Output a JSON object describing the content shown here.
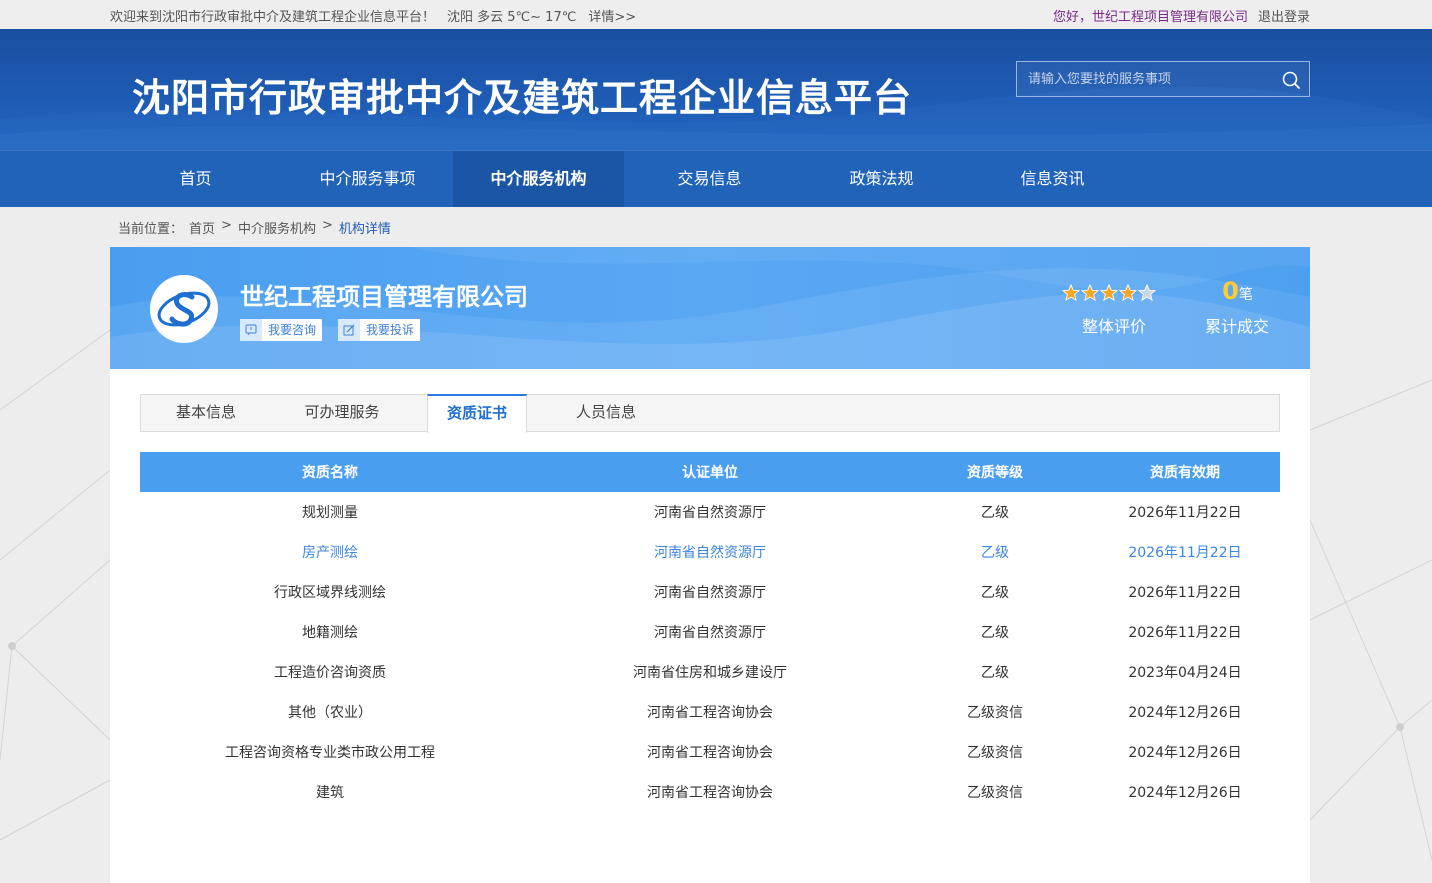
{
  "topbar": {
    "welcome": "欢迎来到沈阳市行政审批中介及建筑工程企业信息平台！",
    "weather": "沈阳 多云 5℃~ 17℃",
    "details": "详情>>",
    "greeting": "您好，世纪工程项目管理有限公司",
    "logout": "退出登录"
  },
  "header": {
    "site_title": "沈阳市行政审批中介及建筑工程企业信息平台",
    "search_placeholder": "请输入您要找的服务事项"
  },
  "nav": {
    "items": [
      "首页",
      "中介服务事项",
      "中介服务机构",
      "交易信息",
      "政策法规",
      "信息资讯"
    ],
    "active": "中介服务机构"
  },
  "breadcrumb": {
    "label": "当前位置：",
    "home": "首页",
    "sep": ">",
    "level1": "中介服务机构",
    "current": "机构详情"
  },
  "company": {
    "name": "世纪工程项目管理有限公司",
    "consult_label": "我要咨询",
    "complain_label": "我要投诉",
    "rating_stars": 4,
    "rating_max": 5,
    "rating_label": "整体评价",
    "deals_count": "0",
    "deals_unit": "笔",
    "deals_label": "累计成交"
  },
  "tabs": {
    "items": [
      "基本信息",
      "可办理服务",
      "资质证书",
      "人员信息"
    ],
    "active": "资质证书"
  },
  "table": {
    "headers": [
      "资质名称",
      "认证单位",
      "资质等级",
      "资质有效期"
    ],
    "rows": [
      [
        "规划测量",
        "河南省自然资源厅",
        "乙级",
        "2026年11月22日"
      ],
      [
        "房产测绘",
        "河南省自然资源厅",
        "乙级",
        "2026年11月22日"
      ],
      [
        "行政区域界线测绘",
        "河南省自然资源厅",
        "乙级",
        "2026年11月22日"
      ],
      [
        "地籍测绘",
        "河南省自然资源厅",
        "乙级",
        "2026年11月22日"
      ],
      [
        "工程造价咨询资质",
        "河南省住房和城乡建设厅",
        "乙级",
        "2023年04月24日"
      ],
      [
        "其他（农业）",
        "河南省工程咨询协会",
        "乙级资信",
        "2024年12月26日"
      ],
      [
        "工程咨询资格专业类市政公用工程",
        "河南省工程咨询协会",
        "乙级资信",
        "2024年12月26日"
      ],
      [
        "建筑",
        "河南省工程咨询协会",
        "乙级资信",
        "2024年12月26日"
      ]
    ],
    "highlighted_row": 1
  },
  "colors": {
    "header_blue": "#1e5cb5",
    "banner_blue": "#4a9ef0",
    "star_orange": "#f5a623",
    "deal_yellow": "#ffcc33",
    "link_blue": "#3b86e0"
  }
}
